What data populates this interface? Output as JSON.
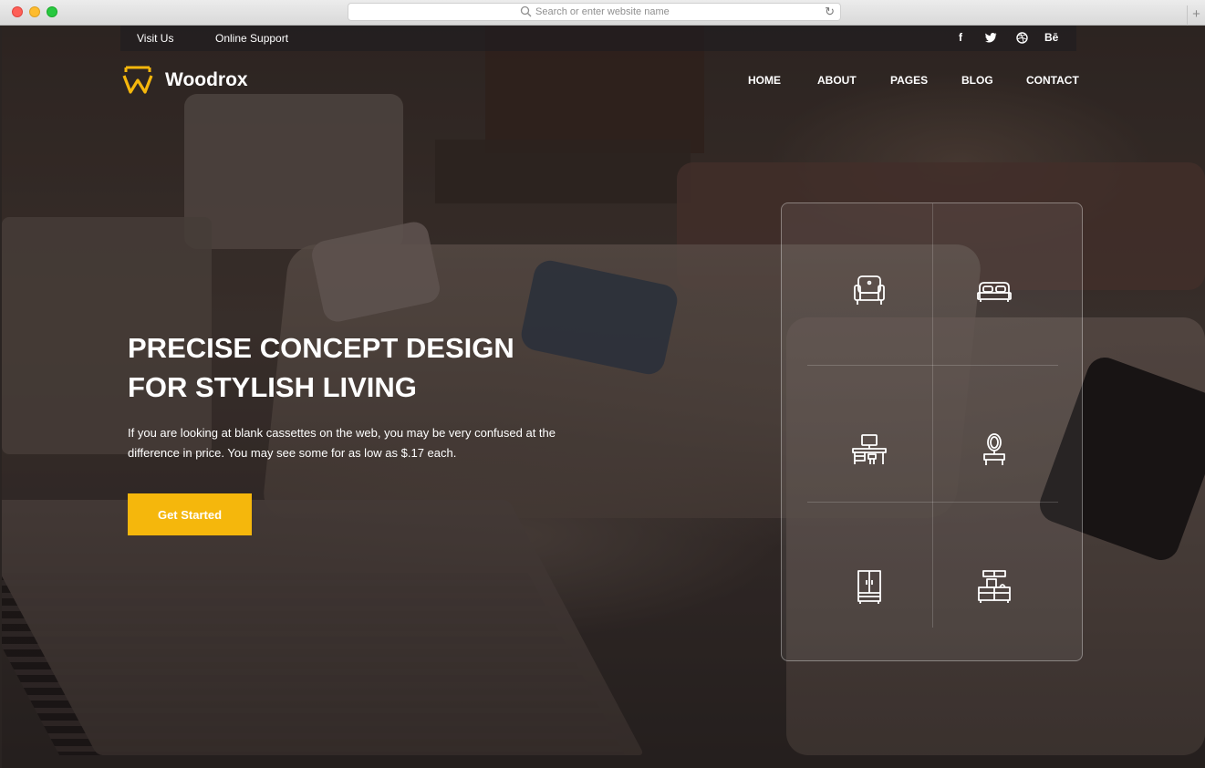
{
  "browser": {
    "url_placeholder": "Search or enter website name"
  },
  "topbar": {
    "visit_us": "Visit Us",
    "online_support": "Online Support",
    "social": [
      "f",
      "t",
      "dribbble",
      "Bē"
    ]
  },
  "brand": {
    "name": "Woodrox",
    "accent": "#f5b70c"
  },
  "nav": {
    "home": "HOME",
    "about": "ABOUT",
    "pages": "PAGES",
    "blog": "BLOG",
    "contact": "CONTACT"
  },
  "hero": {
    "line1": "PRECISE CONCEPT DESIGN",
    "line2": "FOR STYLISH LIVING",
    "subtitle": "If you are looking at blank cassettes on the web, you may be very confused at the difference in price. You may see some for as low as $.17 each.",
    "cta": "Get Started"
  },
  "categories": [
    "armchair-icon",
    "bed-icon",
    "desk-icon",
    "mirror-dresser-icon",
    "wardrobe-icon",
    "tv-cabinet-icon"
  ]
}
